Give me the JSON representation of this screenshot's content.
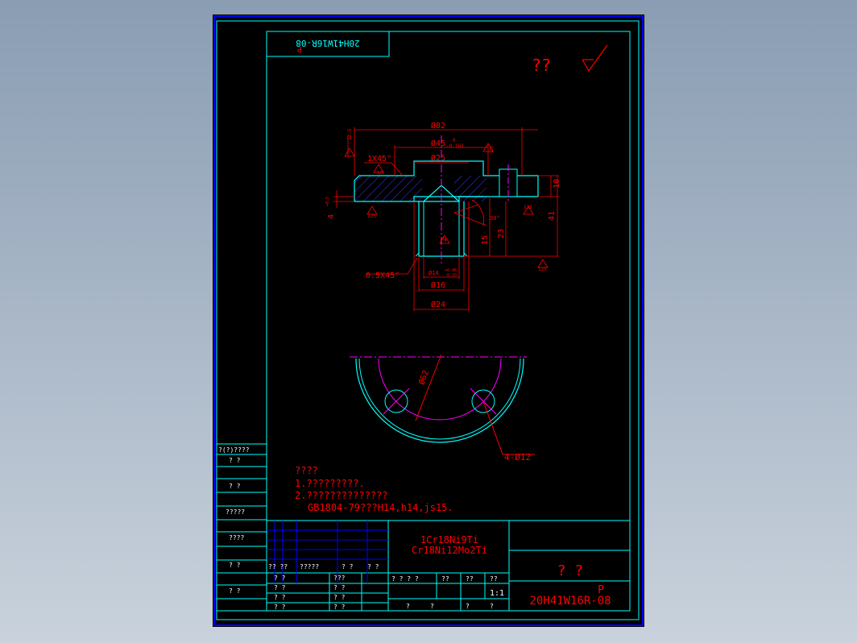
{
  "drawing": {
    "code_mirrored": "20H41W16R-08",
    "code_mirrored_p": "P",
    "roughness_symbol": "??",
    "dims": {
      "d82": "Ø82",
      "d45": "Ø45",
      "d45_tol_upper": "0",
      "d45_tol_lower": "-0.160",
      "d25": "Ø25",
      "chamfer_top": "1X45°",
      "chamfer_bottom": "0.5X45°",
      "d14": "Ø14",
      "d14_tol_upper": "+0.06",
      "d14_tol_lower": "-0.10",
      "d16": "Ø16",
      "d24": "Ø24",
      "h10": "10",
      "h41": "41",
      "h15": "15",
      "h23": "23",
      "h4": "4",
      "h4_tol": "+0.5",
      "h2": "2",
      "angle30": "30°",
      "d62": "Ø62",
      "holes": "4-Ø12",
      "rough_12_5": "12.5",
      "rough_125": "125"
    }
  },
  "notes": {
    "title": "????",
    "line1": "1.?????????.",
    "line2": "2.??????????????",
    "line3": "GB1804-79???H14,h14,js15."
  },
  "left_strip": {
    "cells": [
      "?(?)????",
      "?  ?",
      "?  ?",
      "?????",
      "????",
      "?  ?",
      "?  ?"
    ]
  },
  "title_block": {
    "material1": "1Cr18Ni9Ti",
    "material2": "Cr18Ni12Mo2Ti",
    "part_name": "?   ?",
    "code_p": "P",
    "code": "20H41W16R-08",
    "scale": "1:1",
    "row_labels": [
      "?? ??",
      "?????",
      "? ?",
      "? ?"
    ],
    "left_labels": [
      "? ?",
      "? ?",
      "? ?",
      "? ?"
    ],
    "mid_labels": [
      "???",
      "? ?",
      "? ?",
      "? ?"
    ],
    "info_labels": [
      "? ? ? ?",
      "??",
      "??",
      "??"
    ],
    "bottom_labels": [
      "?",
      "?",
      "?",
      "?"
    ]
  }
}
